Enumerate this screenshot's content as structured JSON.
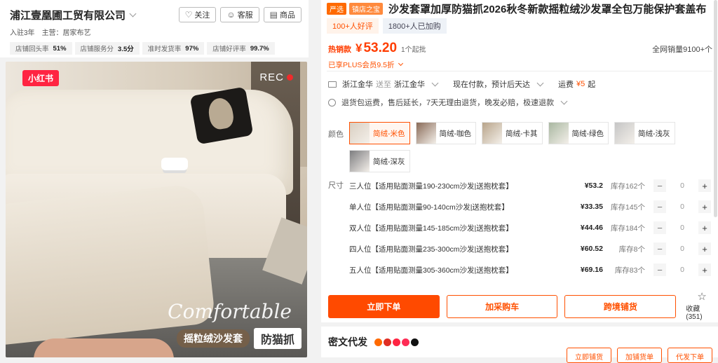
{
  "shop": {
    "name": "浦江壹凰圃工贸有限公司",
    "buttons": [
      {
        "label": "关注",
        "icon": "heart-icon"
      },
      {
        "label": "客服",
        "icon": "chat-icon"
      },
      {
        "label": "商品",
        "icon": "goods-icon"
      }
    ],
    "years": "入驻3年",
    "main_business": "主营：居家布艺",
    "stats": [
      {
        "label": "店铺回头率",
        "value": "51%"
      },
      {
        "label": "店铺服务分",
        "value": "3.5分"
      },
      {
        "label": "准时发货率",
        "value": "97%"
      },
      {
        "label": "店铺好评率",
        "value": "99.7%"
      }
    ]
  },
  "photo": {
    "badge": "小红书",
    "rec": "REC",
    "script_text": "Comfortable",
    "caption_left": "摇粒绒沙发套",
    "caption_right": "防猫抓"
  },
  "product": {
    "tag_strict": "严选",
    "tag_shop": "镇店之宝",
    "title": "沙发套罩加厚防猫抓2026秋冬新款摇粒绒沙发罩全包万能保护套盖布",
    "chip_reviews": "100+人好评",
    "chip_cart": "1800+人已加购",
    "hot_label": "热销款",
    "currency": "¥",
    "price": "53.20",
    "moq": "1个起批",
    "all_sales": "全网销量9100+个",
    "plus_discount": "已享PLUS会员9.5折"
  },
  "shipping": {
    "from": "浙江金华",
    "to_word": "送至",
    "to": "浙江金华",
    "lead": "现在付款，预计后天达",
    "fee_label": "运费",
    "fee": "¥5",
    "fee_suffix": "起"
  },
  "services": "退货包运费，售后延长，7天无理由退货，晚发必赔，极速退款",
  "color_label": "颜色",
  "colors": [
    {
      "label": "简绒-米色",
      "selected": true,
      "swatch": "#d9cfc2"
    },
    {
      "label": "简绒-咖色",
      "selected": false,
      "swatch": "#8a6b58"
    },
    {
      "label": "简绒-卡其",
      "selected": false,
      "swatch": "#b8a48a"
    },
    {
      "label": "简绒-绿色",
      "selected": false,
      "swatch": "#a9b7a1"
    },
    {
      "label": "简绒-浅灰",
      "selected": false,
      "swatch": "#c5c5c5"
    },
    {
      "label": "简绒-深灰",
      "selected": false,
      "swatch": "#7d7d80"
    }
  ],
  "size_label": "尺寸",
  "sizes": [
    {
      "name": "三人位【适用贴面测量190-230cm沙发|送抱枕套】",
      "price": "¥53.2",
      "stock": "库存162个",
      "qty": "0"
    },
    {
      "name": "单人位【适用贴面测量90-140cm沙发|送抱枕套】",
      "price": "¥33.35",
      "stock": "库存145个",
      "qty": "0"
    },
    {
      "name": "双人位【适用贴面测量145-185cm沙发|送抱枕套】",
      "price": "¥44.46",
      "stock": "库存184个",
      "qty": "0"
    },
    {
      "name": "四人位【适用贴面测量235-300cm沙发|送抱枕套】",
      "price": "¥60.52",
      "stock": "库存8个",
      "qty": "0"
    },
    {
      "name": "五人位【适用贴面测量305-360cm沙发|送抱枕套】",
      "price": "¥69.16",
      "stock": "库存83个",
      "qty": "0"
    }
  ],
  "stepper": {
    "minus": "−",
    "plus": "+"
  },
  "actions": {
    "buy_now": "立即下单",
    "add_cart": "加采购车",
    "cross_border": "跨境铺货",
    "favorite": "收藏 (351)"
  },
  "secret_dropship": {
    "title": "密文代发",
    "bottom_buttons": [
      "立即铺货",
      "加铺货单",
      "代发下单"
    ]
  }
}
